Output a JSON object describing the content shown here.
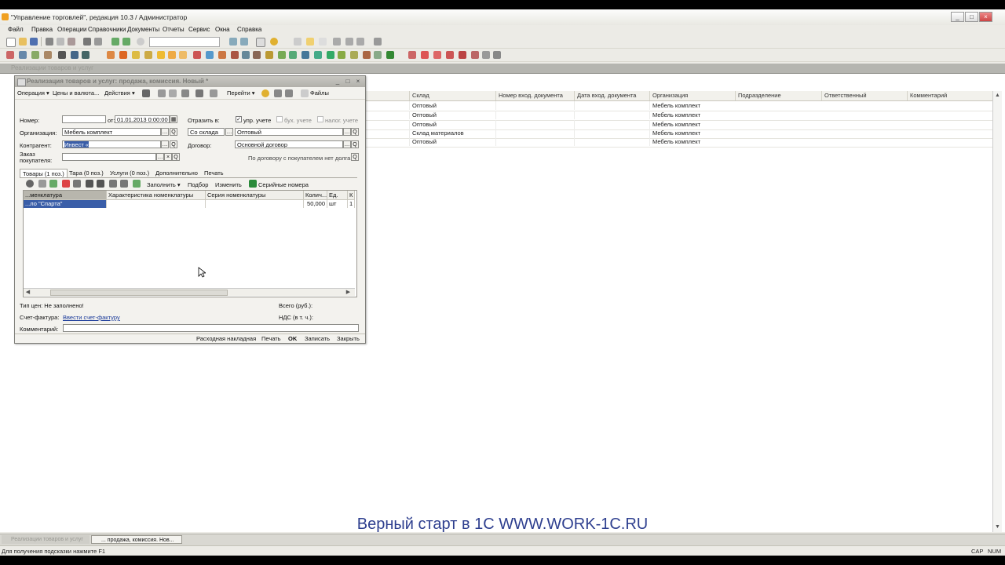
{
  "app": {
    "title": "\"Управление торговлей\", редакция 10.3 / Администратор"
  },
  "menu": [
    "Файл",
    "Правка",
    "Операции",
    "Справочники",
    "Документы",
    "Отчеты",
    "Сервис",
    "Окна",
    "Справка"
  ],
  "list": {
    "columns": [
      "Склад",
      "Номер вход. документа",
      "Дата вход. документа",
      "Организация",
      "Подразделение",
      "Ответственный",
      "Комментарий"
    ],
    "rows": [
      {
        "warehouse": "Оптовый",
        "org": "Мебель комплект"
      },
      {
        "warehouse": "Оптовый",
        "org": "Мебель комплект"
      },
      {
        "warehouse": "Оптовый",
        "org": "Мебель комплект"
      },
      {
        "warehouse": "Склад материалов",
        "org": "Мебель комплект"
      },
      {
        "warehouse": "Оптовый",
        "org": "Мебель комплект"
      }
    ]
  },
  "doc": {
    "title": "Реализация товаров и услуг: продажа, комиссия. Новый *",
    "toolbar": [
      "Операция ▾",
      "Цены и валюта...",
      "Действия ▾",
      "Перейти ▾",
      "Файлы"
    ],
    "labels": {
      "number": "Номер:",
      "from": "от:",
      "organization": "Организация:",
      "counterparty": "Контрагент:",
      "order1": "Заказ",
      "order2": "покупателя:",
      "reflect": "Отразить в:",
      "mgmt": "упр. учете",
      "acc": "бух. учете",
      "tax": "налог. учете",
      "warehouse_btn": "Со склада",
      "contract": "Договор:",
      "price_type": "Тип цен: Не заполнено!",
      "invoice": "Счет-фактура:",
      "invoice_link": "Ввести счет-фактуру",
      "comment": "Комментарий:",
      "total": "Всего (руб.):",
      "vat": "НДС (в т. ч.):"
    },
    "values": {
      "number": "",
      "date": "01.01.2013  0:00:00",
      "organization": "Мебель комплект",
      "counterparty": "Инвест «",
      "order": "",
      "warehouse": "Оптовый",
      "contract": "Основной договор",
      "contract_note": "По договору с покупателем нет долга",
      "comment": ""
    },
    "tabs": [
      "Товары (1 поз.)",
      "Тара (0 поз.)",
      "Услуги (0 поз.)",
      "Дополнительно",
      "Печать"
    ],
    "tab_toolbar": [
      "Заполнить ▾",
      "Подбор",
      "Изменить",
      "Серийные номера"
    ],
    "grid": {
      "headers": [
        "...менклатура",
        "Характеристика номенклатуры",
        "Серия номенклатуры",
        "Колич...",
        "Ед.",
        "К"
      ],
      "row": [
        "...ло \"Спарта\"",
        "",
        "",
        "50,000",
        "шт",
        "1"
      ]
    },
    "bottom_buttons": [
      "Расходная накладная",
      "Печать",
      "OK",
      "Записать",
      "Закрыть"
    ]
  },
  "taskbar": {
    "items": [
      "Реализации товаров и услуг",
      "... продажа, комиссия. Нов..."
    ]
  },
  "overlay": "Верный старт в 1С WWW.WORK-1C.RU",
  "status": {
    "hint": "Для получения подсказки нажмите F1",
    "caps": "CAP",
    "num": "NUM"
  },
  "mdi_caption": "Реализации товаров и услуг"
}
